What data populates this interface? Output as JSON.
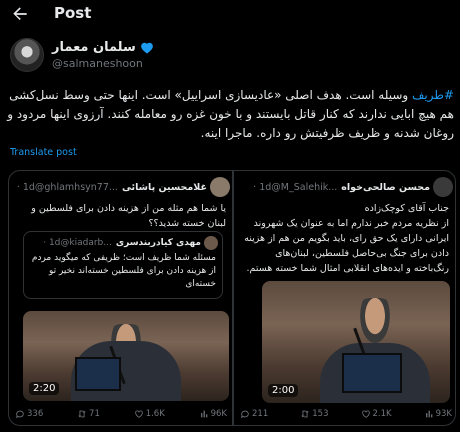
{
  "header": {
    "title": "Post"
  },
  "author": {
    "name": "سلمان معمار",
    "handle": "@salmaneshoon"
  },
  "tweet": {
    "hashtag": "#طریف",
    "text": " وسیله است. هدف اصلی «عادیسازی اسراییل» است. اینها حتی وسط نسل‌کشی هم هیچ ابایی ندارند که کنار قاتل بایستند و با خون غزه رو معامله کنند. آرزوی اینها مردود و روغان شدنه و ظریف ظرفیتش رو داره. ماجرا اینه."
  },
  "translate_label": "Translate post",
  "quotes": [
    {
      "name": "غلامحسین پاشائی",
      "handle": "@ghlamhsyn77...",
      "time": "· 1d",
      "text": "یا شما هم مثله من از هزینه دادن برای فلسطین و لبنان خسته شدید؟؟",
      "inner": {
        "name": "مهدی کیادربندسری",
        "handle": "@kiadarb...",
        "time": "· 1d",
        "text": "مسئله شما ظریف است؛ ظریفی که میگوید مردم از هزینه دادن برای فلسطین خسته‌اند نخیر تو خسته‌ای"
      },
      "video_time": "2:20",
      "stats": {
        "replies": "336",
        "reposts": "71",
        "likes": "1.6K",
        "views": "96K"
      }
    },
    {
      "name": "محسن صالحی‌خواه",
      "handle": "@M_Salehik...",
      "time": "· 1d",
      "text": "جناب آقای کوچک‌زاده\nاز نظریه مردم خبر ندارم اما به عنوان یک شهروند ایرانی دارای یک حق رای، باید بگویم من هم از هزینه دادن برای جنگ بی‌حاصل فلسطین، لبنان‌های رنگ‌باخته و ایده‌های انقلابی امثال شما خسته هستم.",
      "video_time": "2:00",
      "stats": {
        "replies": "211",
        "reposts": "153",
        "likes": "2.1K",
        "views": "93K"
      }
    }
  ]
}
